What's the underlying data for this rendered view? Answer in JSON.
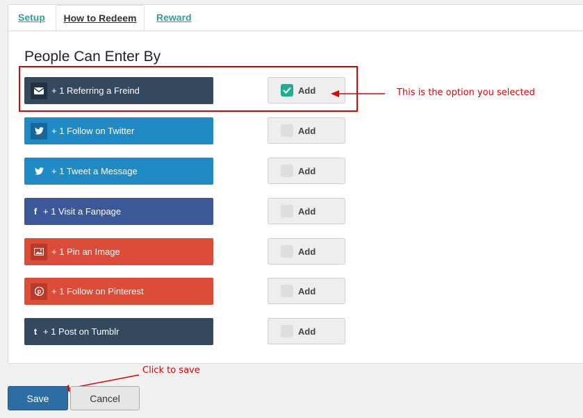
{
  "tabs": [
    {
      "label": "Setup"
    },
    {
      "label": "How to Redeem"
    },
    {
      "label": "Reward"
    }
  ],
  "section_title": "People Can Enter By",
  "entries": [
    {
      "label": "+ 1 Referring a Freind",
      "icon": "envelope-icon",
      "color": "#34495e",
      "add_label": "Add",
      "checked": true
    },
    {
      "label": "+ 1 Follow on Twitter",
      "icon": "twitter-icon",
      "color": "#1f8ac6",
      "add_label": "Add",
      "checked": false
    },
    {
      "label": "+ 1 Tweet a Message",
      "icon": "twitter-icon",
      "color": "#1f8ac6",
      "add_label": "Add",
      "checked": false
    },
    {
      "label": "+ 1 Visit a Fanpage",
      "icon": "facebook-icon",
      "color": "#3b5998",
      "add_label": "Add",
      "checked": false
    },
    {
      "label": "+ 1 Pin an Image",
      "icon": "image-icon",
      "color": "#dd4b39",
      "add_label": "Add",
      "checked": false
    },
    {
      "label": "+ 1 Follow on Pinterest",
      "icon": "pinterest-icon",
      "color": "#dd4b39",
      "add_label": "Add",
      "checked": false
    },
    {
      "label": "+ 1 Post on Tumblr",
      "icon": "tumblr-icon",
      "color": "#34495e",
      "add_label": "Add",
      "checked": false
    }
  ],
  "annotations": {
    "selected_note": "This is the option you selected",
    "save_note": "Click to save"
  },
  "footer": {
    "save_label": "Save",
    "cancel_label": "Cancel"
  }
}
